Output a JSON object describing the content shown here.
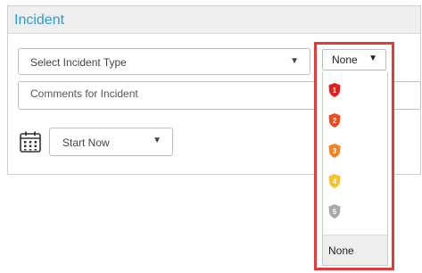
{
  "panel": {
    "title": "Incident"
  },
  "incident_type": {
    "placeholder": "Select Incident Type",
    "caret": "▼"
  },
  "comments": {
    "placeholder": "Comments for Incident"
  },
  "schedule": {
    "value": "Start Now",
    "caret": "▼",
    "icon": "calendar-icon"
  },
  "priority": {
    "selected": "None",
    "caret": "▼",
    "options": [
      {
        "number": "1",
        "color": "#e0201b",
        "icon": "shield-icon"
      },
      {
        "number": "2",
        "color": "#f04a1c",
        "icon": "shield-icon"
      },
      {
        "number": "3",
        "color": "#f58220",
        "icon": "shield-icon"
      },
      {
        "number": "4",
        "color": "#f5c328",
        "icon": "shield-icon"
      },
      {
        "number": "5",
        "color": "#a8a8a8",
        "icon": "shield-icon"
      }
    ],
    "none_label": "None",
    "highlight_color": "#e23b3b"
  }
}
